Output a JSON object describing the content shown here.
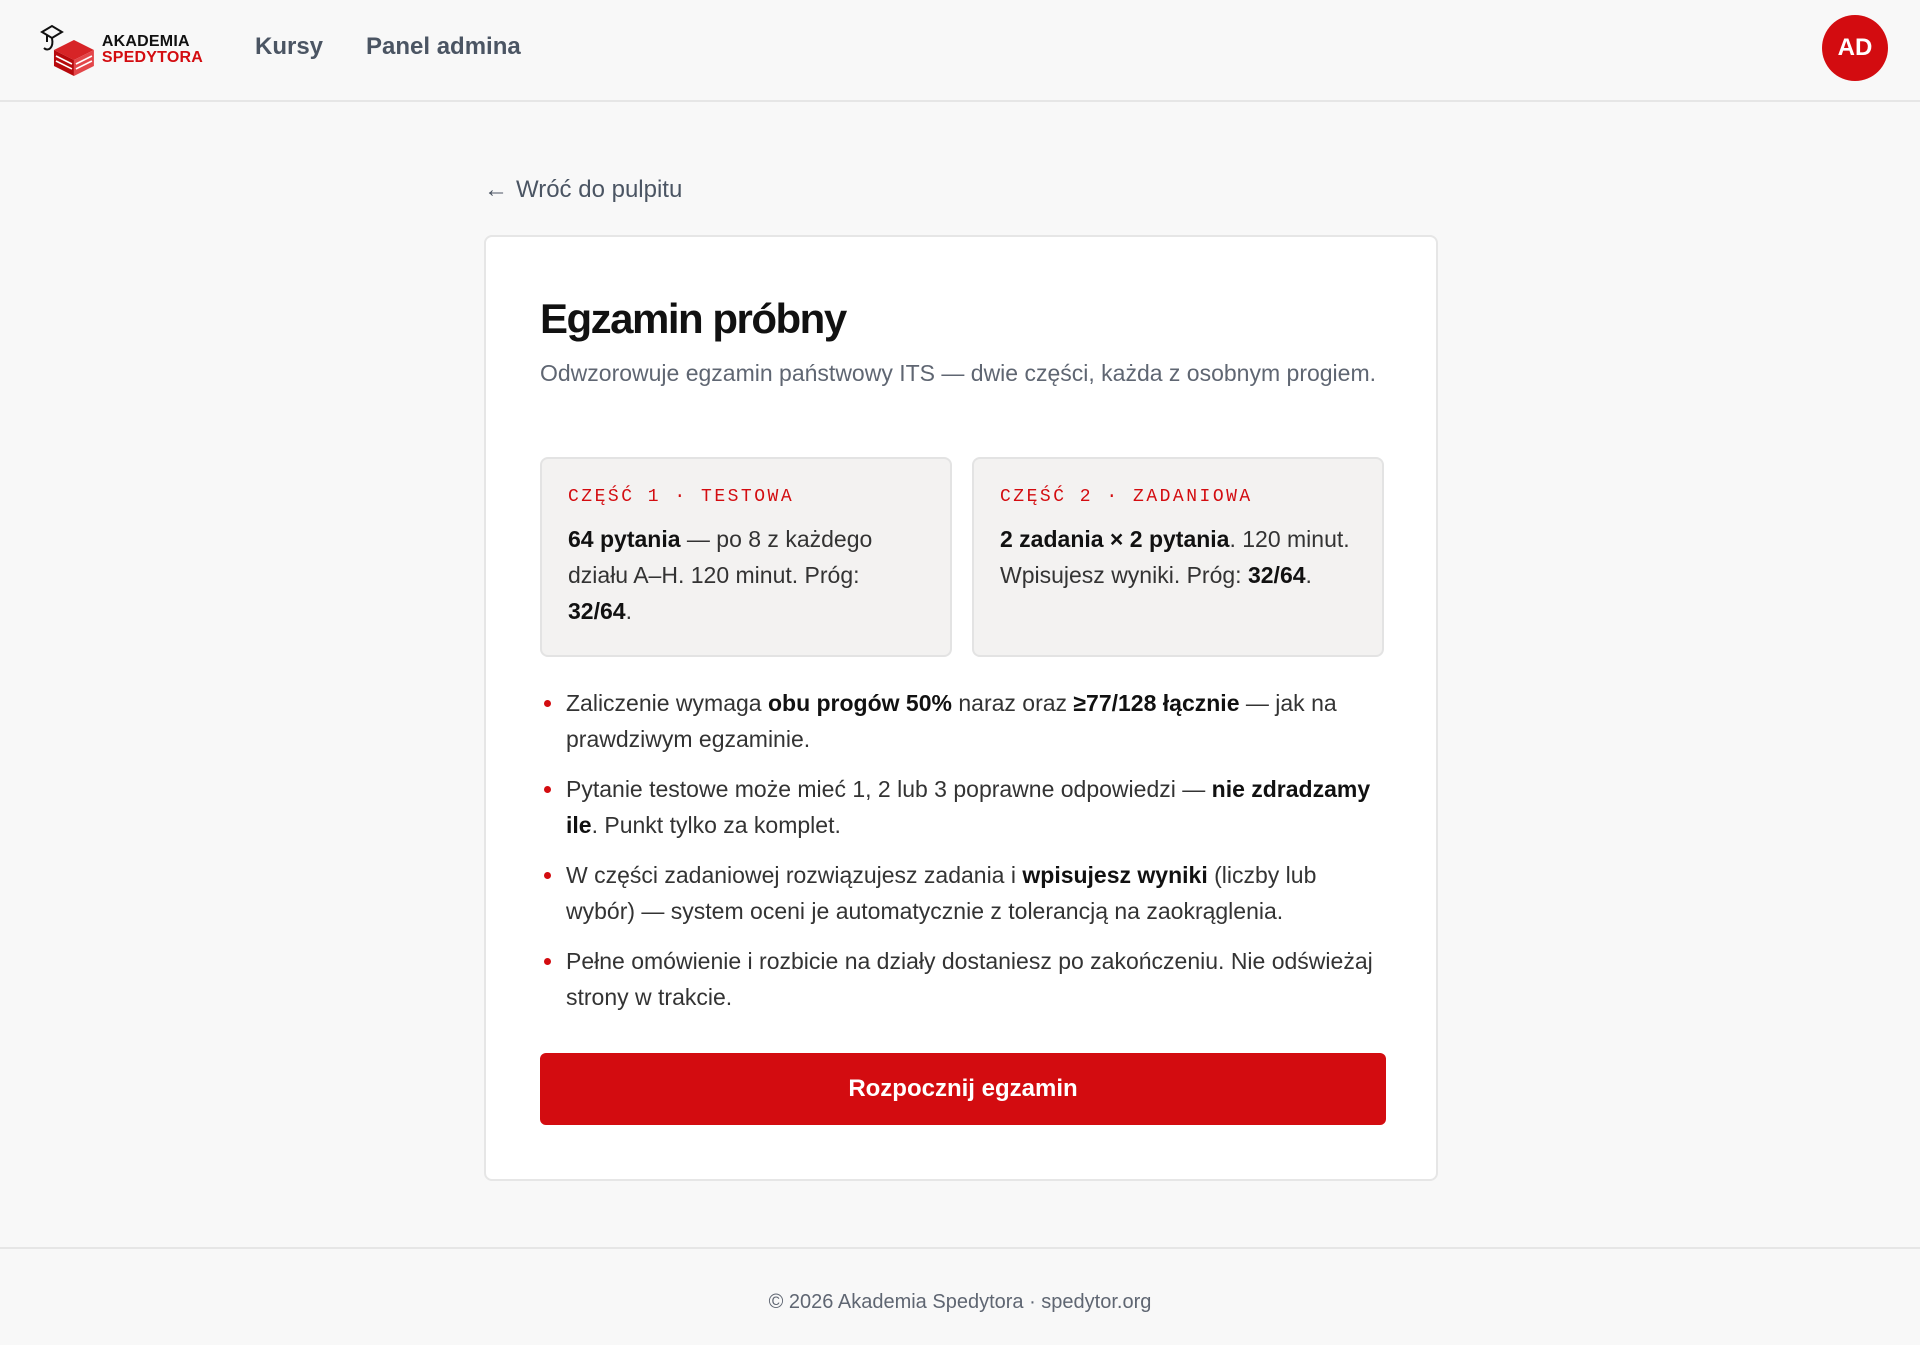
{
  "brand": {
    "line1": "AKADEMIA",
    "line2": "SPEDYTORA",
    "accent": "#d30c10"
  },
  "nav": {
    "courses": "Kursy",
    "admin_panel": "Panel admina"
  },
  "user": {
    "initials": "AD"
  },
  "back_link": {
    "arrow": "←",
    "label": "Wróć do pulpitu"
  },
  "exam": {
    "title": "Egzamin próbny",
    "subtitle": "Odwzorowuje egzamin państwowy ITS — dwie części, każda z osobnym progiem.",
    "parts": [
      {
        "label": "CZĘŚĆ 1 · TESTOWA",
        "bold1": "64 pytania",
        "text1": " — po 8 z każdego działu A–H. 120 minut. Próg: ",
        "bold2": "32/64",
        "text2": "."
      },
      {
        "label": "CZĘŚĆ 2 · ZADANIOWA",
        "bold1": "2 zadania × 2 pytania",
        "text1": ". 120 minut. Wpisujesz wyniki. Próg: ",
        "bold2": "32/64",
        "text2": "."
      }
    ],
    "rules": [
      {
        "t1": "Zaliczenie wymaga ",
        "b1": "obu progów 50%",
        "t2": " naraz oraz ",
        "b2": "≥77/128 łącznie",
        "t3": " — jak na prawdziwym egzaminie."
      },
      {
        "t1": "Pytanie testowe może mieć 1, 2 lub 3 poprawne odpowiedzi — ",
        "b1": "nie zdradzamy ile",
        "t2": ". Punkt tylko za komplet.",
        "b2": "",
        "t3": ""
      },
      {
        "t1": "W części zadaniowej rozwiązujesz zadania i ",
        "b1": "wpisujesz wyniki",
        "t2": " (liczby lub wybór) — system oceni je automatycznie z tolerancją na zaokrąglenia.",
        "b2": "",
        "t3": ""
      },
      {
        "t1": "Pełne omówienie i rozbicie na działy dostaniesz po zakończeniu. Nie odświeżaj strony w trakcie.",
        "b1": "",
        "t2": "",
        "b2": "",
        "t3": ""
      }
    ],
    "start_button": "Rozpocznij egzamin"
  },
  "footer": {
    "text": "© 2026 Akademia Spedytora · spedytor.org"
  }
}
